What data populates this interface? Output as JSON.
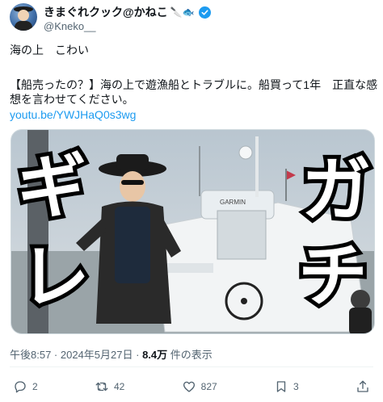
{
  "author": {
    "display_name": "きまぐれクック@かねこ",
    "handle": "@Kneko__",
    "badge_emojis": "🔪🐟",
    "verified_icon": "verified-badge-icon"
  },
  "tweet": {
    "line1": "海の上　こわい",
    "line2": "【船売ったの？】海の上で遊漁船とトラブルに。船買って1年　正直な感",
    "line3": "想を言わせてください。",
    "link": "youtu.be/YWJHaQ0s3wg"
  },
  "media": {
    "overlay_left_1": "ギ",
    "overlay_left_2": "レ",
    "overlay_right_1": "ガ",
    "overlay_right_2": "チ",
    "boat_brand": "GARMIN"
  },
  "meta": {
    "time": "午後8:57",
    "separator": " · ",
    "date": "2024年5月27日",
    "views_count": "8.4万",
    "views_label": " 件の表示"
  },
  "actions": {
    "reply_count": "2",
    "retweet_count": "42",
    "like_count": "827",
    "bookmark_count": "3"
  },
  "colors": {
    "accent": "#1d9bf0",
    "secondary_text": "#536471",
    "divider": "#eff3f4"
  }
}
